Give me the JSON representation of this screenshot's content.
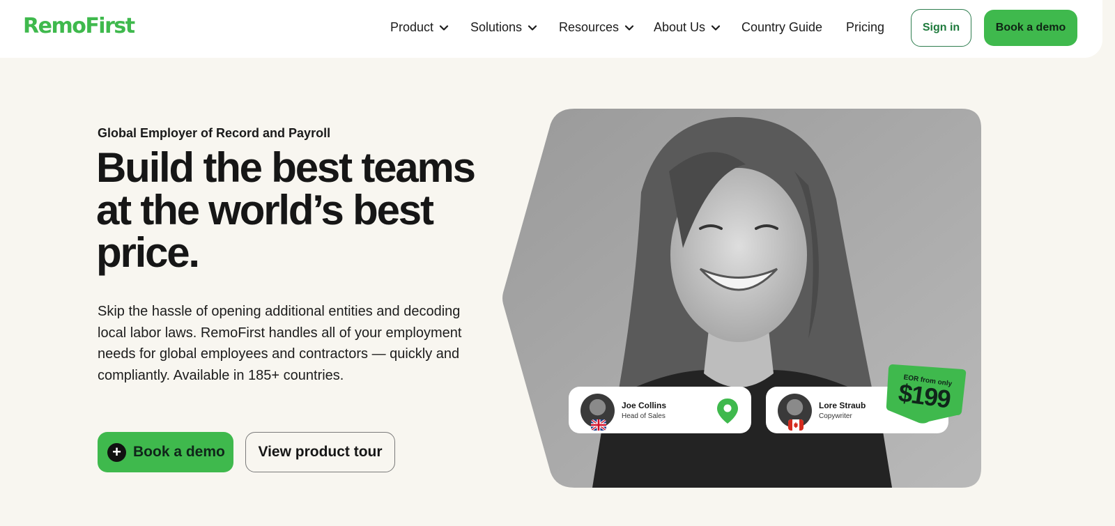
{
  "brand": {
    "name": "RemoFirst",
    "color": "#3fb94d"
  },
  "nav": {
    "items": [
      {
        "label": "Product",
        "has_dropdown": true
      },
      {
        "label": "Solutions",
        "has_dropdown": true
      },
      {
        "label": "Resources",
        "has_dropdown": true
      },
      {
        "label": "About Us",
        "has_dropdown": true
      },
      {
        "label": "Country Guide",
        "has_dropdown": false
      },
      {
        "label": "Pricing",
        "has_dropdown": false
      }
    ],
    "sign_in": "Sign in",
    "book_demo": "Book a demo"
  },
  "hero": {
    "eyebrow": "Global Employer of Record and Payroll",
    "headline": "Build the best teams at the world’s best price.",
    "body": "Skip the hassle of opening additional entities and decoding local labor laws. RemoFirst handles all of your employment needs for global employees and contractors — quickly and compliantly. Available in 185+ countries.",
    "primary_cta": "Book a demo",
    "secondary_cta": "View product tour"
  },
  "cards": [
    {
      "name": "Joe Collins",
      "role": "Head of Sales",
      "flag": "uk-flag-icon",
      "icon": "location-pin-icon"
    },
    {
      "name": "Lore Straub",
      "role": "Copywriter",
      "flag": "canada-flag-icon"
    }
  ],
  "price_badge": {
    "caption": "EOR from only",
    "price": "$199"
  },
  "icons": [
    "chevron-down-icon",
    "plus-circle-icon",
    "location-pin-icon",
    "uk-flag-icon",
    "canada-flag-icon"
  ]
}
